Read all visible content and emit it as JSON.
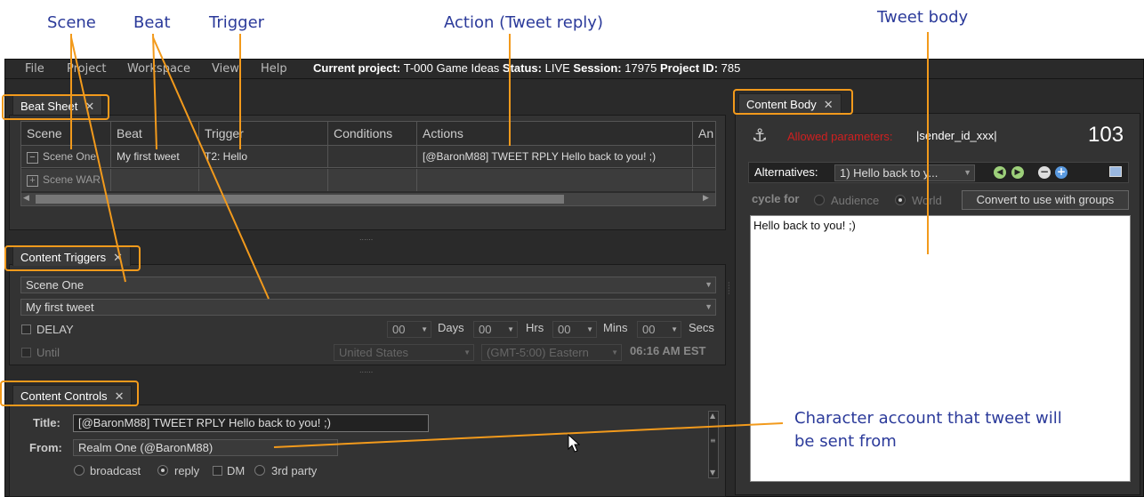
{
  "annotations": {
    "scene": "Scene",
    "beat": "Beat",
    "trigger": "Trigger",
    "action": "Action (Tweet reply)",
    "tweet_body": "Tweet body",
    "character_line1": "Character account that tweet will",
    "character_line2": "be sent from"
  },
  "menu": [
    "File",
    "Project",
    "Workspace",
    "View",
    "Help"
  ],
  "project": {
    "current_label": "Current project:",
    "current_value": "T-000 Game Ideas",
    "status_label": "Status:",
    "status_value": "LIVE",
    "session_label": "Session:",
    "session_value": "17975",
    "id_label": "Project ID:",
    "id_value": "785"
  },
  "beat_sheet": {
    "tab": "Beat Sheet",
    "columns": [
      "Scene",
      "Beat",
      "Trigger",
      "Conditions",
      "Actions",
      "An"
    ],
    "rows": [
      {
        "toggle": "−",
        "scene": "Scene One",
        "beat": "My first tweet",
        "trigger": "T2: Hello",
        "conditions": "",
        "actions": "[@BaronM88] TWEET RPLY Hello back to you! ;)"
      },
      {
        "toggle": "+",
        "scene": "Scene WAR",
        "beat": "",
        "trigger": "",
        "conditions": "",
        "actions": ""
      }
    ]
  },
  "content_triggers": {
    "tab": "Content Triggers",
    "scene": "Scene One",
    "beat": "My first tweet",
    "delay_label": "DELAY",
    "until_label": "Until",
    "days": "00",
    "days_label": "Days",
    "hrs": "00",
    "hrs_label": "Hrs",
    "mins": "00",
    "mins_label": "Mins",
    "secs": "00",
    "secs_label": "Secs",
    "country": "United States",
    "timezone": "(GMT-5:00) Eastern",
    "time": "06:16 AM EST"
  },
  "content_controls": {
    "tab": "Content Controls",
    "title_label": "Title:",
    "title_value": "[@BaronM88] TWEET RPLY Hello back to you! ;)",
    "from_label": "From:",
    "from_value": "Realm One (@BaronM88)",
    "opt_broadcast": "broadcast",
    "opt_reply": "reply",
    "opt_dm": "DM",
    "opt_third": "3rd party"
  },
  "content_body": {
    "tab": "Content Body",
    "anchor_icon": "⚓",
    "allowed_label": "Allowed parameters:",
    "allowed_value": "|sender_id_xxx|",
    "count": "103",
    "alternatives_label": "Alternatives:",
    "alternative_selected": "1) Hello back to y...",
    "cycle_label": "cycle for",
    "audience": "Audience",
    "world": "World",
    "convert_button": "Convert to use with groups",
    "body_text": "Hello back to you! ;)"
  },
  "colors": {
    "accent": "#f29a1c",
    "annotation": "#2b3a9a",
    "warning": "#d02020",
    "background": "#2a2a2a"
  }
}
